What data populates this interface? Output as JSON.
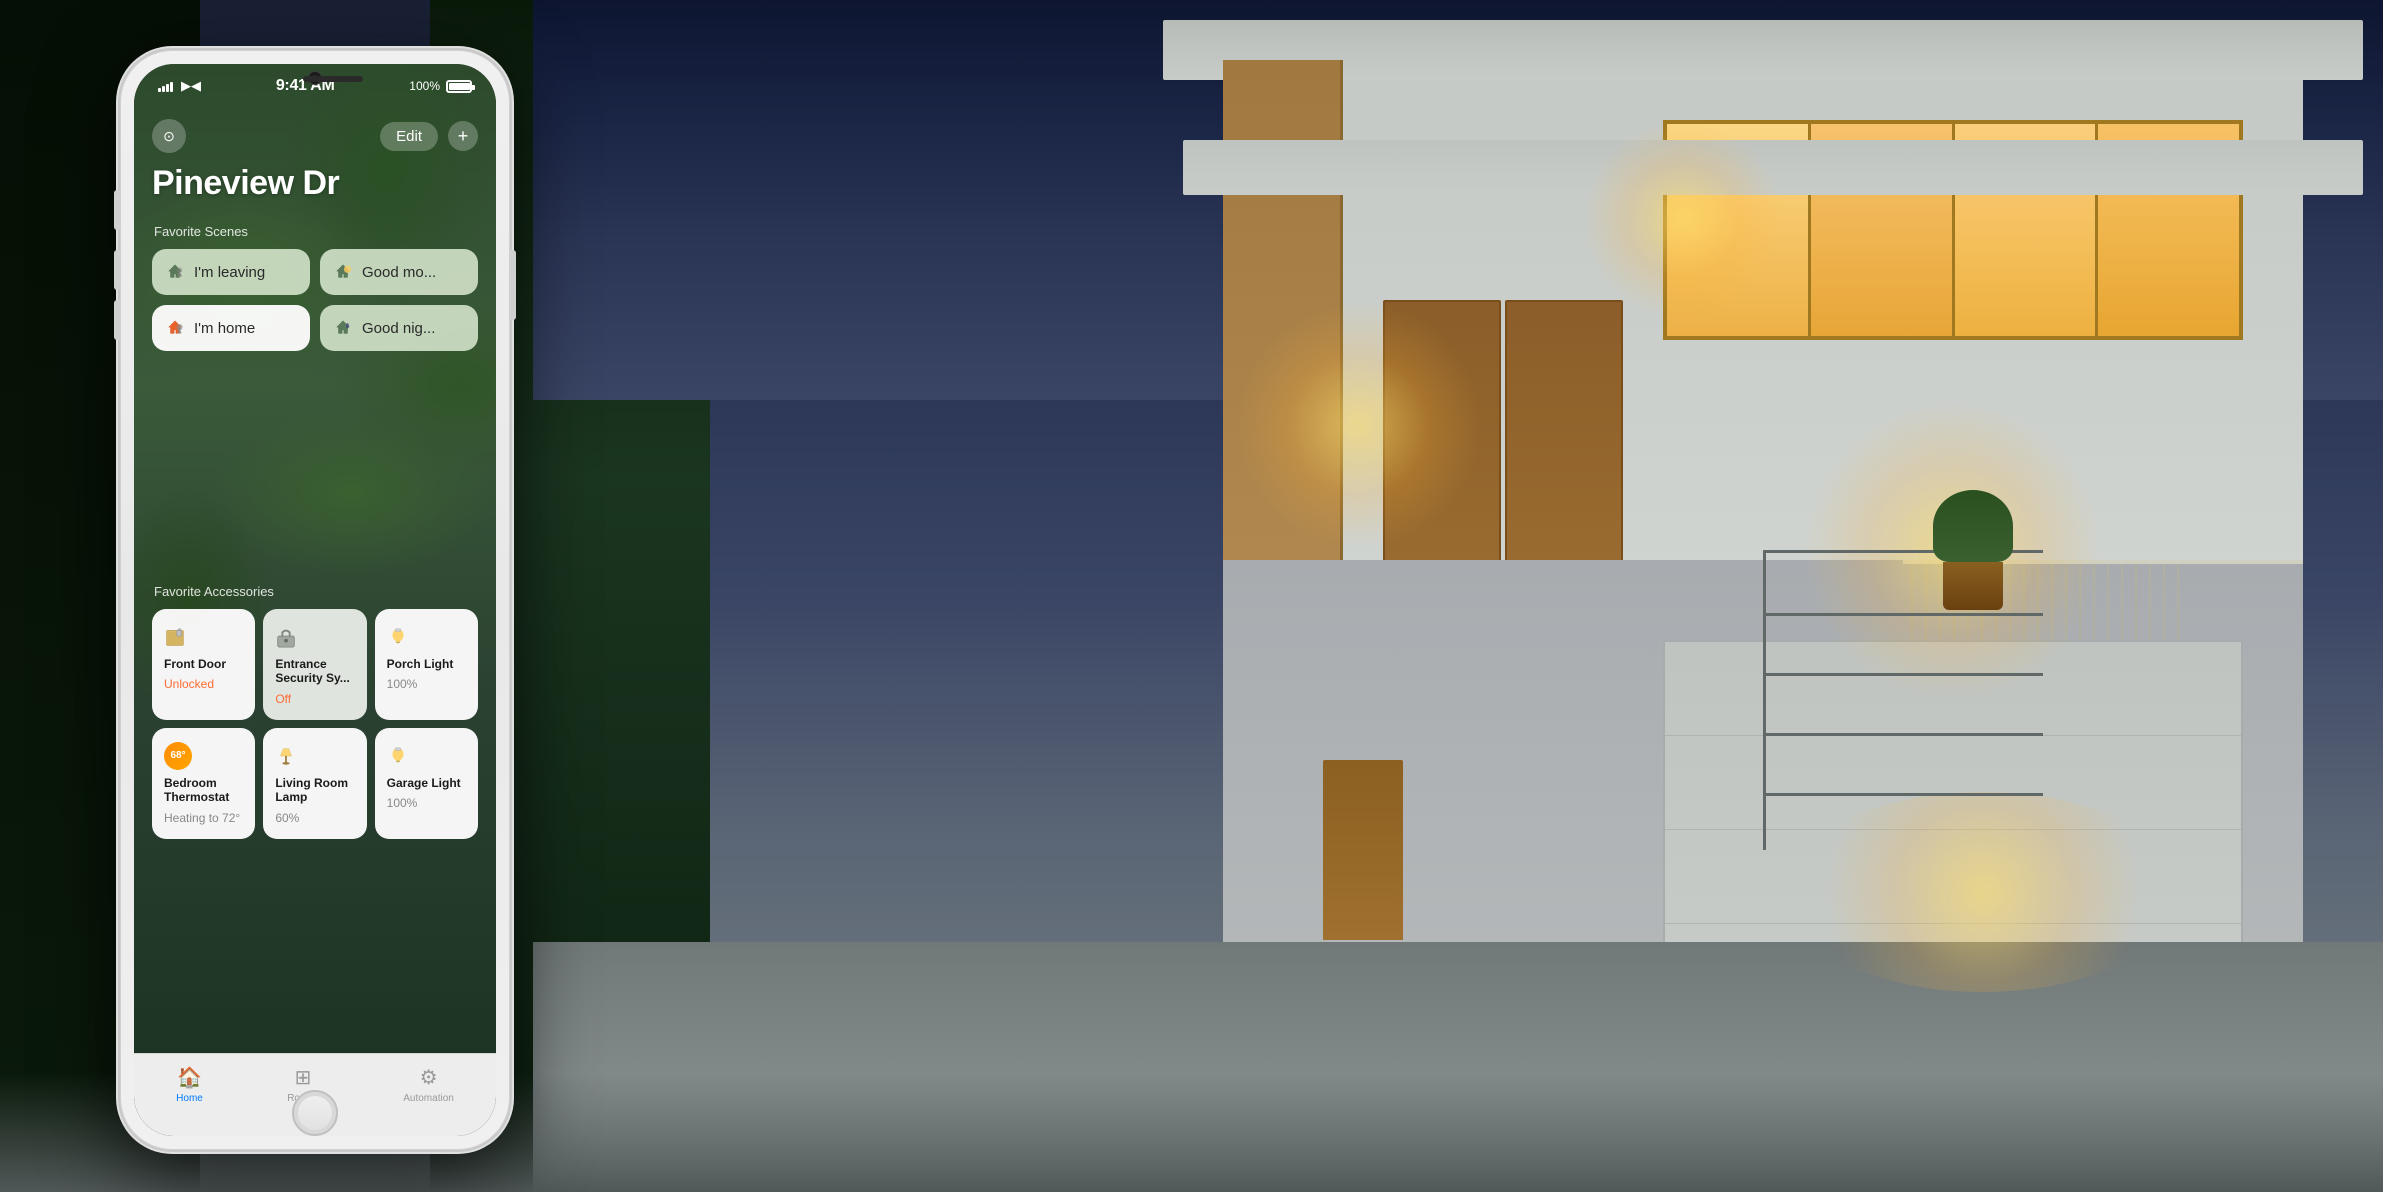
{
  "background": {
    "description": "Modern house exterior at night with lighting"
  },
  "status_bar": {
    "signal": "●●●●",
    "wifi": "wifi",
    "time": "9:41 AM",
    "battery": "100%"
  },
  "nav": {
    "location_icon": "⊙",
    "edit_label": "Edit",
    "add_label": "+"
  },
  "home": {
    "title": "Pineview Dr"
  },
  "favorite_scenes": {
    "label": "Favorite Scenes",
    "items": [
      {
        "id": "leaving",
        "icon": "🏠",
        "label": "I'm leaving",
        "active": false
      },
      {
        "id": "good-morning",
        "icon": "🌤",
        "label": "Good mo...",
        "active": false
      },
      {
        "id": "home",
        "icon": "🏠",
        "label": "I'm home",
        "active": true
      },
      {
        "id": "good-night",
        "icon": "🌙",
        "label": "Good nig...",
        "active": false
      }
    ]
  },
  "favorite_accessories": {
    "label": "Favorite Accessories",
    "items": [
      {
        "id": "front-door",
        "icon": "🔓",
        "name": "Front Door",
        "status": "Unlocked",
        "status_type": "unlocked",
        "active": true
      },
      {
        "id": "entrance-security",
        "icon": "🔒",
        "name": "Entrance Security Sy...",
        "status": "Off",
        "status_type": "off",
        "active": false
      },
      {
        "id": "porch-light",
        "icon": "💡",
        "name": "Porch Light",
        "status": "100%",
        "status_type": "on",
        "active": true
      },
      {
        "id": "bedroom-thermostat",
        "icon": "🌡",
        "name": "Bedroom Thermostat",
        "status": "Heating to 72°",
        "status_type": "on",
        "badge": "68°",
        "active": true
      },
      {
        "id": "living-room-lamp",
        "icon": "🪔",
        "name": "Living Room Lamp",
        "status": "60%",
        "status_type": "on",
        "active": true
      },
      {
        "id": "garage-light",
        "icon": "💡",
        "name": "Garage Light",
        "status": "100%",
        "status_type": "on",
        "active": true
      }
    ]
  }
}
